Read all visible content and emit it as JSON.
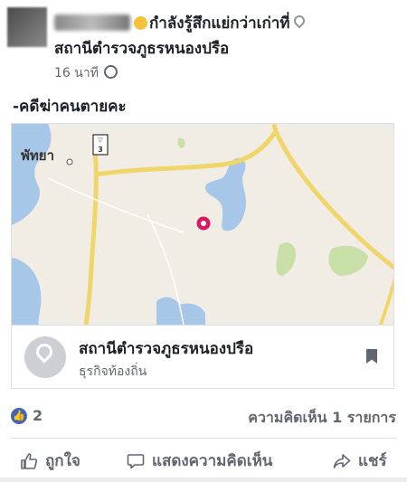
{
  "post": {
    "feeling": "กำลังรู้สึกแย่กว่าเก่าที่",
    "location": "สถานีตำรวจภูธรหนองปรือ",
    "time": "16 นาที",
    "text": "-คดีฆ่าคนตายคะ"
  },
  "map": {
    "city_label": "พัทยา",
    "highway_number": "3"
  },
  "place_card": {
    "title": "สถานีตำรวจภูธรหนองปรือ",
    "subtitle": "ธุรกิจท้องถิ่น"
  },
  "stats": {
    "reactions": "2",
    "comments": "ความคิดเห็น 1 รายการ"
  },
  "actions": {
    "like": "ถูกใจ",
    "comment": "แสดงความคิดเห็น",
    "share": "แชร์"
  },
  "colors": {
    "map_land": "#f2ede4",
    "map_water": "#a6c7e8",
    "map_road": "#f0d66a",
    "map_park": "#c8dfa8",
    "pin_red": "#d81b60",
    "like_blue": "#4267b2"
  }
}
